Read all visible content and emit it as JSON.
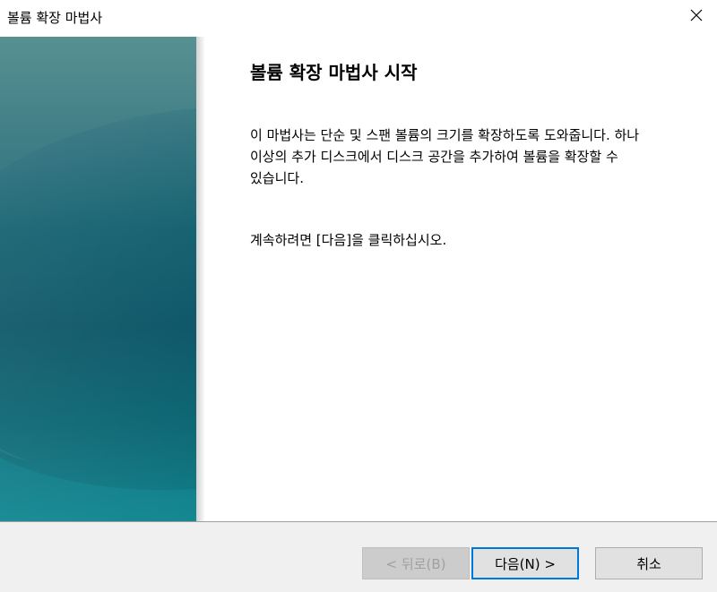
{
  "window": {
    "title": "볼륨 확장 마법사"
  },
  "main": {
    "heading": "볼륨 확장 마법사 시작",
    "description": "이 마법사는 단순 및 스팬 볼륨의 크기를 확장하도록 도와줍니다. 하나 이상의 추가 디스크에서 디스크 공간을 추가하여 볼륨을 확장할 수 있습니다.",
    "instruction": "계속하려면 [다음]을 클릭하십시오."
  },
  "footer": {
    "back_label": "< 뒤로(B)",
    "next_label": "다음(N) >",
    "cancel_label": "취소"
  },
  "colors": {
    "banner_top": "#4f8a8c",
    "banner_mid": "#0a5466",
    "banner_bottom": "#12808a",
    "focus_border": "#0078d7"
  }
}
